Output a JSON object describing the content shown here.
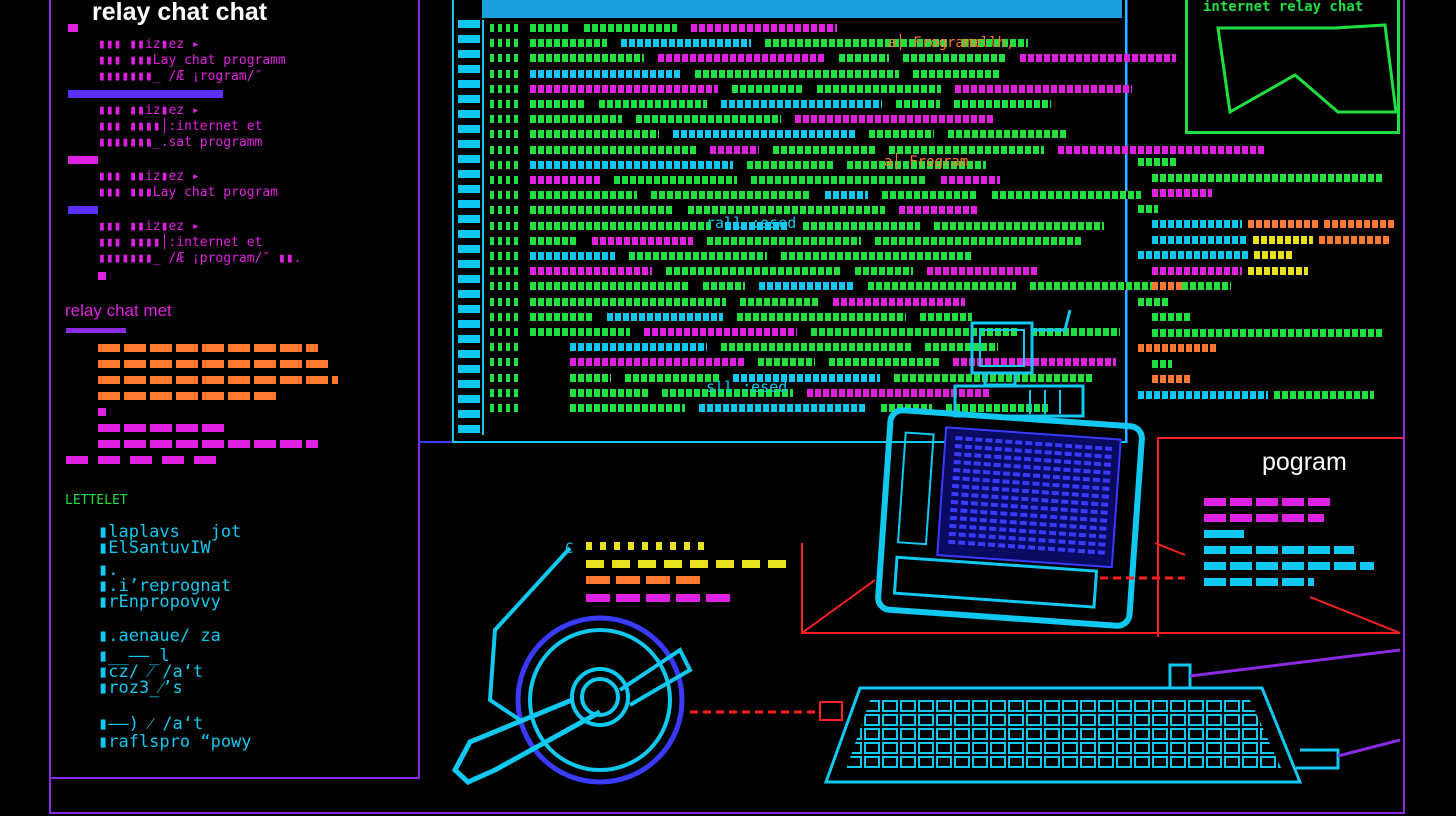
{
  "colors": {
    "magenta": "#e020e0",
    "violet": "#8a2be2",
    "blue": "#3a3aff",
    "cyan": "#10c8f0",
    "green": "#20e040",
    "orange": "#ff7a30",
    "yellow": "#e8e020",
    "red": "#ff2020",
    "white": "#ffffff"
  },
  "left_panel": {
    "title": "relay chat chat",
    "lines": [
      {
        "label": "▮▮▮ ▮▮iz▮ez ▸",
        "color": "#e020e0"
      },
      {
        "label": "▮▮▮ ▮▮▮Lay chat programm",
        "color": "#e020e0"
      },
      {
        "label": "▮▮▮▮▮▮▮_ /Æ ¡rogram/″",
        "color": "#e020e0"
      },
      {
        "label": "▮▮▮ ▮▮iz▮ez ▸",
        "color": "#e020e0"
      },
      {
        "label": "▮▮▮ ▮▮▮▮│:internet et",
        "color": "#e020e0"
      },
      {
        "label": "▮▮▮▮▮▮▮_.sat programm",
        "color": "#e020e0"
      },
      {
        "label": "▮▮▮ ▮▮iz▮ez ▸",
        "color": "#e020e0"
      },
      {
        "label": "▮▮▮ ▮▮▮Lay chat program",
        "color": "#e020e0"
      },
      {
        "label": "▮▮▮ ▮▮iz▮ez ▸",
        "color": "#e020e0"
      },
      {
        "label": "▮▮▮ ▮▮▮▮│:internet et",
        "color": "#e020e0"
      },
      {
        "label": "▮▮▮▮▮▮▮_ /Æ ¡program/″ ▮▮.",
        "color": "#e020e0"
      }
    ],
    "section2_title": "relay chat met",
    "section3_title": "LETTELET",
    "cyan_lines": [
      "▮laplavs   jot",
      "▮ElSantuvIW",
      "▮.",
      "▮.i’reprognat",
      "▮rEnpropovvy",
      "▮.aenaue/ za",
      "▮__——_l",
      "▮cz/ ⁄ /a‘t",
      "▮roz3_⁄’s",
      "▮——) ⁄ /a‘t",
      "▮raflspro “powy"
    ]
  },
  "top_right_panel": {
    "title": "internet relay chat"
  },
  "right_panel": {
    "label": "pogram"
  },
  "terminal": {
    "lines": [
      "rall :esed",
      "sll :esed",
      "a│ Frogramællh,",
      "a│ Frogram"
    ]
  },
  "icons": [
    "monitor-icon",
    "tablet-icon",
    "disc-icon",
    "keyboard-icon",
    "connector-icon"
  ]
}
